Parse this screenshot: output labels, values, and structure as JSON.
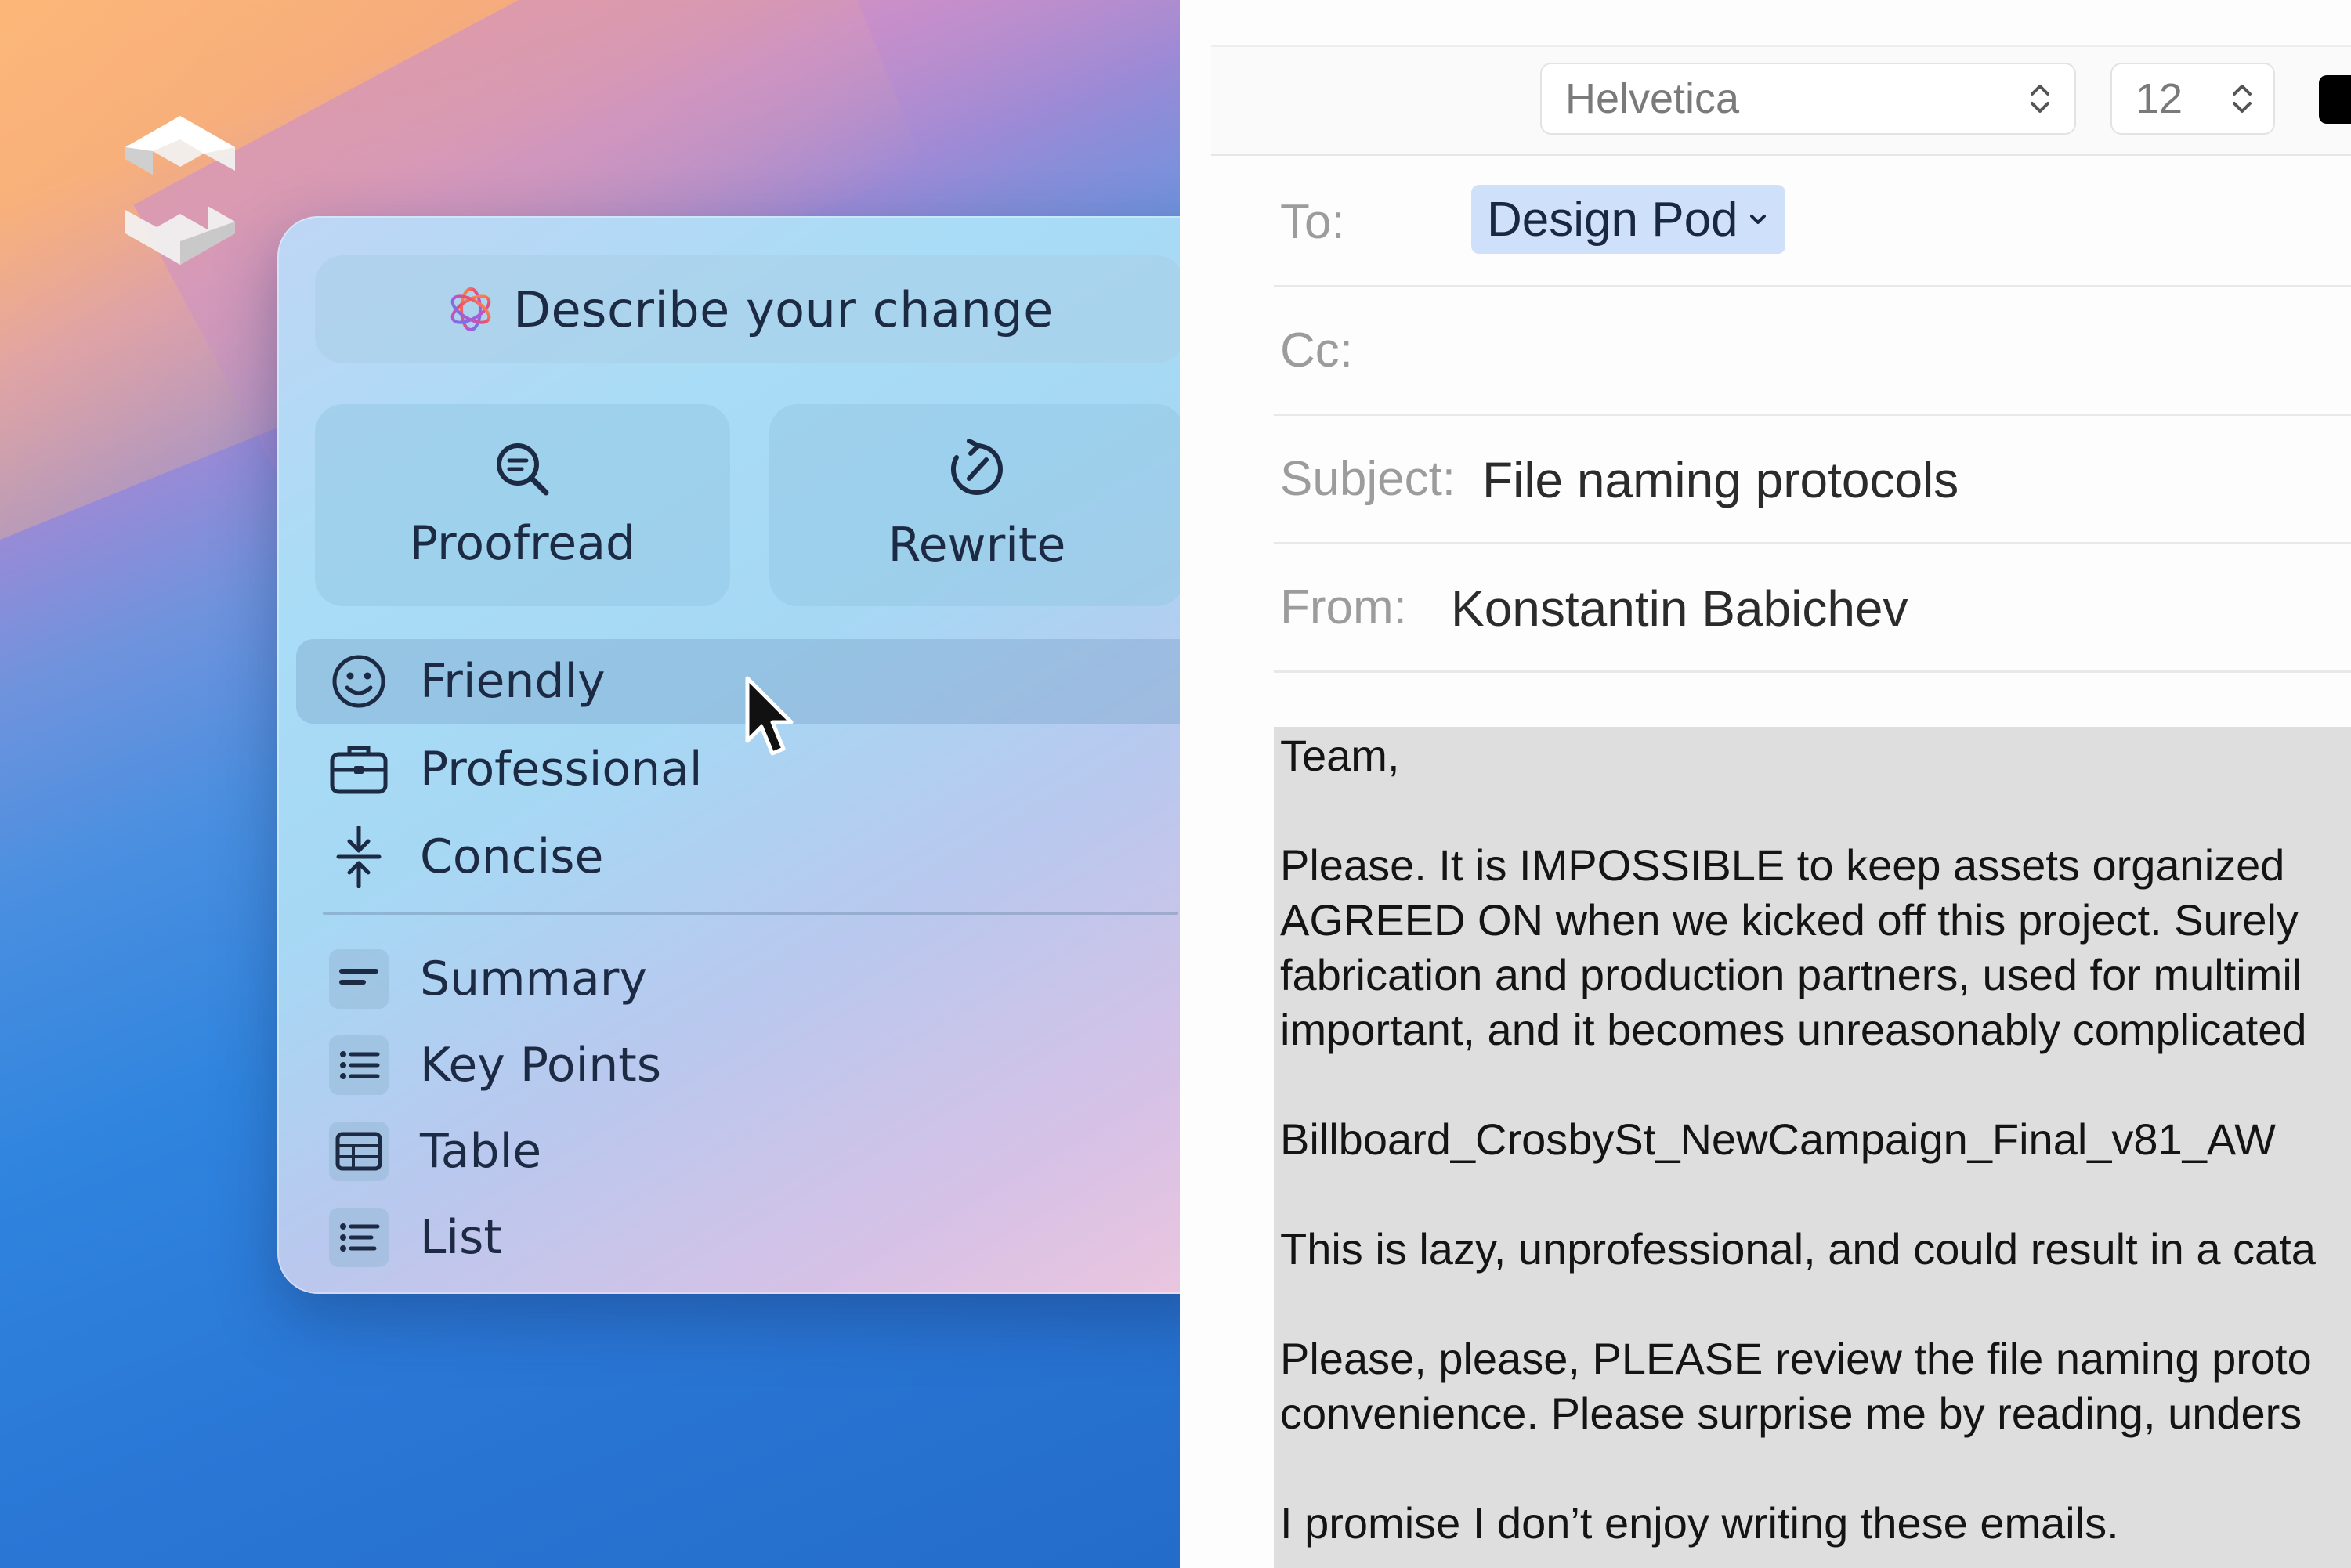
{
  "writing_tools": {
    "describe_placeholder": "Describe your change",
    "actions": {
      "proofread": "Proofread",
      "rewrite": "Rewrite"
    },
    "tones": [
      {
        "label": "Friendly",
        "icon": "smiley-icon",
        "active": true
      },
      {
        "label": "Professional",
        "icon": "briefcase-icon",
        "active": false
      },
      {
        "label": "Concise",
        "icon": "compress-arrows-icon",
        "active": false
      }
    ],
    "transforms": [
      {
        "label": "Summary",
        "icon": "summary-lines-icon"
      },
      {
        "label": "Key Points",
        "icon": "bulleted-list-icon"
      },
      {
        "label": "Table",
        "icon": "table-icon"
      },
      {
        "label": "List",
        "icon": "list-icon"
      }
    ]
  },
  "mail": {
    "toolbar": {
      "font": "Helvetica",
      "size": "12",
      "text_color": "#000000"
    },
    "to_label": "To:",
    "to_value": "Design Pod",
    "cc_label": "Cc:",
    "cc_value": "",
    "subject_label": "Subject:",
    "subject_value": "File naming protocols",
    "from_label": "From:",
    "from_value": "Konstantin Babichev",
    "body_lines": [
      "Team,",
      "Please. It is IMPOSSIBLE to keep assets organized",
      "AGREED ON when we kicked off this project. Surely",
      "fabrication and production partners, used for multimil",
      "important, and it becomes unreasonably complicated",
      "Billboard_CrosbySt_NewCampaign_Final_v81_AW",
      "This is lazy, unprofessional, and could result in a cata",
      "Please, please, PLEASE review the file naming proto",
      "convenience. Please surprise me by reading, unders",
      "I promise I don’t enjoy writing these emails."
    ]
  },
  "colors": {
    "accent_chip": "#cfe0fb",
    "selection_bg": "#dedede"
  }
}
